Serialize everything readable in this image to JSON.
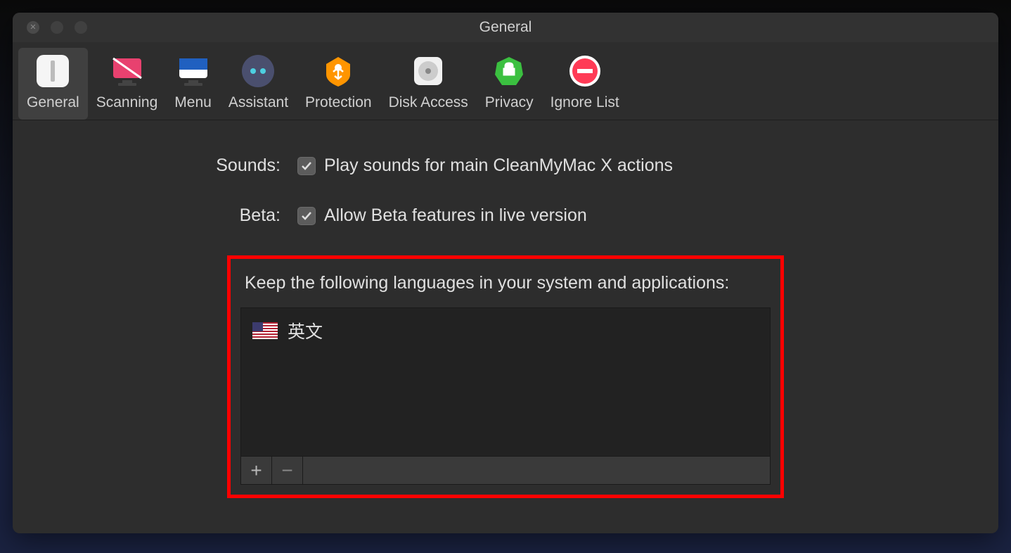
{
  "window": {
    "title": "General"
  },
  "toolbar": {
    "items": [
      {
        "label": "General",
        "active": true
      },
      {
        "label": "Scanning",
        "active": false
      },
      {
        "label": "Menu",
        "active": false
      },
      {
        "label": "Assistant",
        "active": false
      },
      {
        "label": "Protection",
        "active": false
      },
      {
        "label": "Disk Access",
        "active": false
      },
      {
        "label": "Privacy",
        "active": false
      },
      {
        "label": "Ignore List",
        "active": false
      }
    ]
  },
  "form": {
    "sounds_label": "Sounds:",
    "sounds_checkbox_label": "Play sounds for main CleanMyMac X actions",
    "sounds_checked": true,
    "beta_label": "Beta:",
    "beta_checkbox_label": "Allow Beta features in live version",
    "beta_checked": true
  },
  "languages": {
    "heading": "Keep the following languages in your system and applications:",
    "items": [
      {
        "flag": "us",
        "name": "英文"
      }
    ],
    "add_symbol": "+",
    "remove_symbol": "−"
  }
}
